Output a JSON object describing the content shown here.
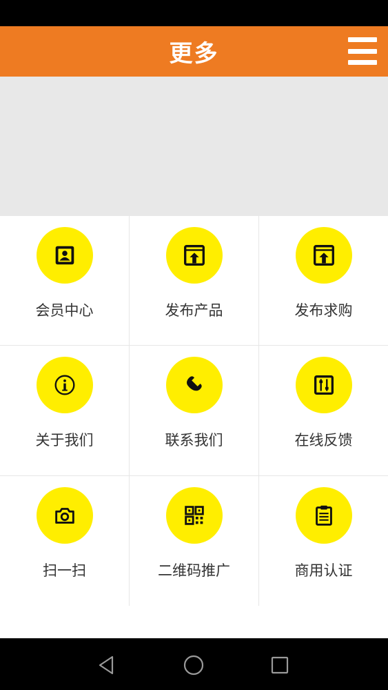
{
  "header": {
    "title": "更多",
    "menu_icon": "hamburger-menu-icon"
  },
  "colors": {
    "accent": "#EE7B22",
    "icon_bg": "#FFEE00",
    "banner_bg": "#E8E8E8"
  },
  "grid": {
    "items": [
      {
        "label": "会员中心",
        "icon": "member-card-icon"
      },
      {
        "label": "发布产品",
        "icon": "publish-upload-icon"
      },
      {
        "label": "发布求购",
        "icon": "publish-upload-icon"
      },
      {
        "label": "关于我们",
        "icon": "info-icon"
      },
      {
        "label": "联系我们",
        "icon": "phone-icon"
      },
      {
        "label": "在线反馈",
        "icon": "feedback-sliders-icon"
      },
      {
        "label": "扫一扫",
        "icon": "camera-icon"
      },
      {
        "label": "二维码推广",
        "icon": "qr-code-icon"
      },
      {
        "label": "商用认证",
        "icon": "clipboard-icon"
      }
    ]
  },
  "navigation": {
    "back": "back-triangle-icon",
    "home": "home-circle-icon",
    "recent": "recent-square-icon"
  }
}
